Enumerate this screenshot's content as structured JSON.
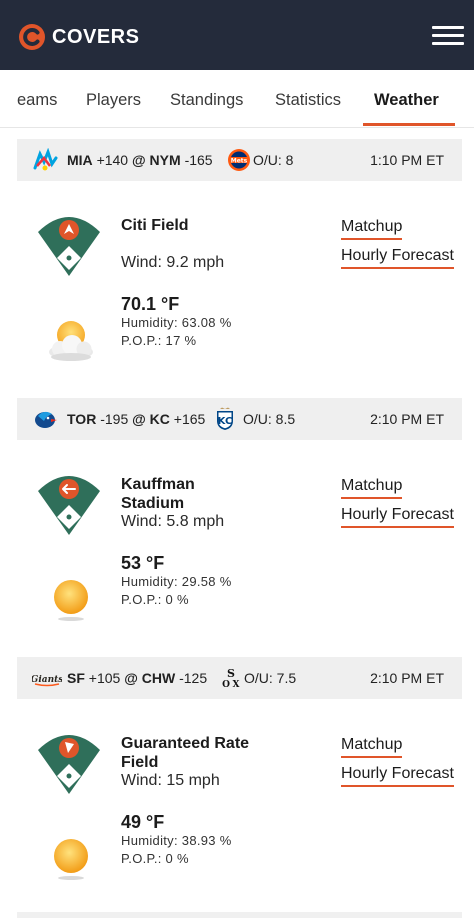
{
  "header": {
    "brand": "COVERS",
    "menu_icon": "hamburger-menu-icon",
    "logo_icon": "covers-logo-icon"
  },
  "tabs": [
    {
      "label": "eams"
    },
    {
      "label": "Players"
    },
    {
      "label": "Standings"
    },
    {
      "label": "Statistics"
    },
    {
      "label": "Weather",
      "active": true
    }
  ],
  "colors": {
    "accent": "#e0552a",
    "header_bg": "#242b3b",
    "field_green": "#2f6f5a",
    "game_bar_bg": "#efefef"
  },
  "games": [
    {
      "away": {
        "abbr": "MIA",
        "odds": "+140",
        "logo": "marlins-logo-icon"
      },
      "at": "@",
      "home": {
        "abbr": "NYM",
        "odds": "-165",
        "logo": "mets-logo-icon"
      },
      "ou": "O/U: 8",
      "time": "1:10 PM ET",
      "venue": "Citi Field",
      "wind": "Wind: 9.2 mph",
      "temp": "70.1 °F",
      "humidity": "Humidity: 63.08 %",
      "pop": "P.O.P.: 17 %",
      "weather_icon": "partly-cloudy-icon",
      "links": {
        "matchup": "Matchup",
        "hourly": "Hourly Forecast"
      }
    },
    {
      "away": {
        "abbr": "TOR",
        "odds": "-195",
        "logo": "blue-jays-logo-icon"
      },
      "at": "@",
      "home": {
        "abbr": "KC",
        "odds": "+165",
        "logo": "royals-logo-icon"
      },
      "ou": "O/U: 8.5",
      "time": "2:10 PM ET",
      "venue": "Kauffman Stadium",
      "wind": "Wind: 5.8 mph",
      "temp": "53 °F",
      "humidity": "Humidity: 29.58 %",
      "pop": "P.O.P.: 0 %",
      "weather_icon": "sunny-icon",
      "links": {
        "matchup": "Matchup",
        "hourly": "Hourly Forecast"
      }
    },
    {
      "away": {
        "abbr": "SF",
        "odds": "+105",
        "logo": "giants-logo-icon"
      },
      "at": "@",
      "home": {
        "abbr": "CHW",
        "odds": "-125",
        "logo": "white-sox-logo-icon"
      },
      "ou": "O/U: 7.5",
      "time": "2:10 PM ET",
      "venue": "Guaranteed Rate Field",
      "wind": "Wind: 15 mph",
      "temp": "49 °F",
      "humidity": "Humidity: 38.93 %",
      "pop": "P.O.P.: 0 %",
      "weather_icon": "sunny-icon",
      "links": {
        "matchup": "Matchup",
        "hourly": "Hourly Forecast"
      }
    }
  ]
}
